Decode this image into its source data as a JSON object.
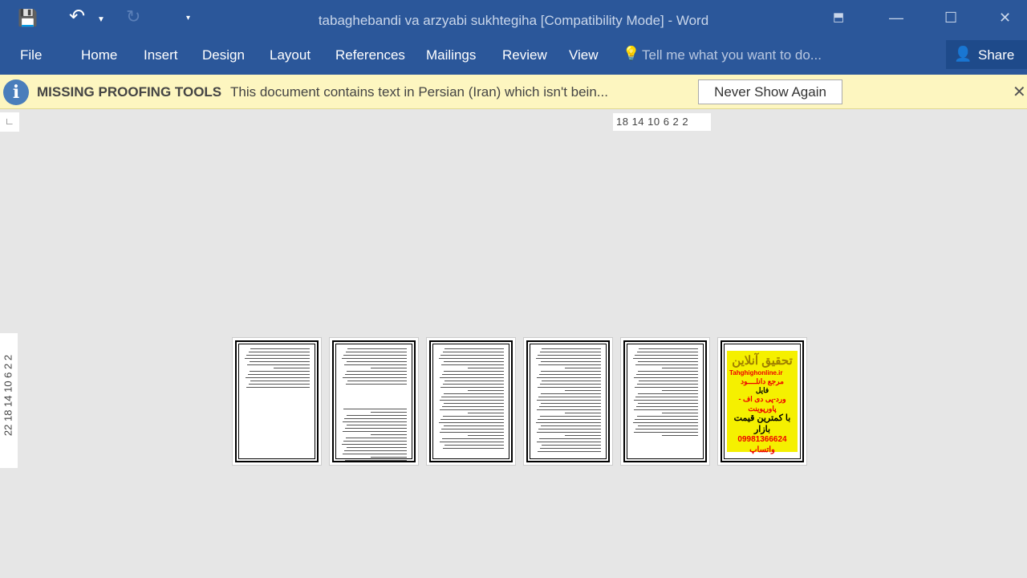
{
  "window": {
    "title": "tabaghebandi va arzyabi sukhtegiha [Compatibility Mode] - Word"
  },
  "qat": {
    "save": "save-icon",
    "undo": "undo-icon",
    "redo": "redo-icon",
    "customize": "customize-icon"
  },
  "ribbon": {
    "tabs": [
      "File",
      "Home",
      "Insert",
      "Design",
      "Layout",
      "References",
      "Mailings",
      "Review",
      "View"
    ],
    "tell_me": "Tell me what you want to do...",
    "share": "Share"
  },
  "message_bar": {
    "title": "MISSING PROOFING TOOLS",
    "text": "This document contains text in Persian (Iran) which isn't bein...",
    "button": "Never Show Again"
  },
  "ruler": {
    "horizontal": "18 14 10  6   2  2",
    "vertical": "22 18 14 10  6  2    2"
  },
  "ad": {
    "line1": "تحقیق آنلاین",
    "site": "Tahghighonline.ir",
    "line2": "مرجع دانلــــود",
    "line3": "فایل",
    "line4": "ورد-پی دی اف - پاورپوینت",
    "line5": "با کمترین قیمت بازار",
    "phone": "09981366624 واتساپ"
  },
  "colors": {
    "accent": "#2b579a",
    "message_bar": "#fdf6c0"
  }
}
